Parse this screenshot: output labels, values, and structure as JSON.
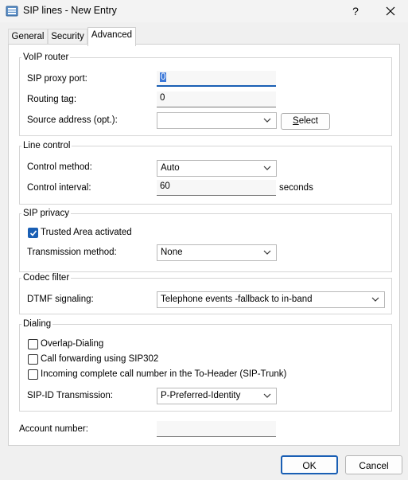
{
  "window": {
    "title": "SIP lines - New Entry",
    "help_label": "?",
    "close_label": "✕"
  },
  "tabs": [
    {
      "label": "General",
      "active": false
    },
    {
      "label": "Security",
      "active": false
    },
    {
      "label": "Advanced",
      "active": true
    }
  ],
  "voip_router": {
    "legend": "VoIP router",
    "sip_proxy_port": {
      "label": "SIP proxy port:",
      "value": "0"
    },
    "routing_tag": {
      "label": "Routing tag:",
      "value": "0"
    },
    "source_address": {
      "label": "Source address (opt.):",
      "value": "",
      "select_label": "Select",
      "select_mnemonic": "S",
      "select_rest": "elect"
    }
  },
  "line_control": {
    "legend": "Line control",
    "control_method": {
      "label": "Control method:",
      "value": "Auto"
    },
    "control_interval": {
      "label": "Control interval:",
      "value": "60",
      "unit": "seconds"
    }
  },
  "sip_privacy": {
    "legend": "SIP privacy",
    "trusted_area": {
      "label": "Trusted Area activated",
      "checked": true
    },
    "transmission_method": {
      "label": "Transmission method:",
      "value": "None"
    }
  },
  "codec_filter": {
    "legend": "Codec filter",
    "dtmf": {
      "label": "DTMF signaling:",
      "value": "Telephone events -fallback to in-band"
    }
  },
  "dialing": {
    "legend": "Dialing",
    "overlap_dialing": {
      "label": "Overlap-Dialing",
      "checked": false
    },
    "call_forwarding": {
      "label": "Call forwarding using SIP302",
      "checked": false
    },
    "incoming_complete": {
      "label": "Incoming complete call number in the To-Header (SIP-Trunk)",
      "checked": false
    },
    "sip_id": {
      "label": "SIP-ID Transmission:",
      "value": "P-Preferred-Identity"
    }
  },
  "account_number": {
    "label": "Account number:",
    "value": ""
  },
  "footer": {
    "ok_label": "OK",
    "cancel_label": "Cancel"
  },
  "colors": {
    "accent": "#1a5fb4",
    "panel_bg": "#ffffff",
    "window_bg": "#f0f0f0"
  }
}
